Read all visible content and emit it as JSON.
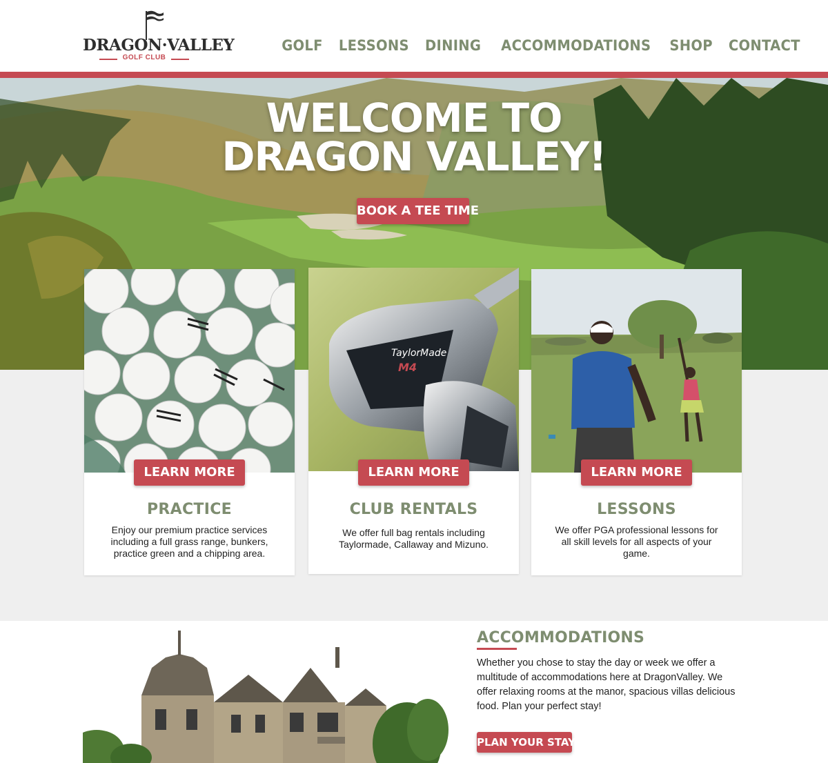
{
  "brand": {
    "name_line": "DRAGON·VALLEY",
    "sub": "GOLF CLUB"
  },
  "nav": {
    "items": [
      "GOLF",
      "LESSONS",
      "DINING",
      "ACCOMMODATIONS",
      "SHOP",
      "CONTACT"
    ]
  },
  "hero": {
    "title_line1": "WELCOME TO",
    "title_line2": "DRAGON VALLEY!",
    "cta": "BOOK A TEE TIME"
  },
  "cards": [
    {
      "title": "PRACTICE",
      "button": "LEARN MORE",
      "description": "Enjoy our premium practice services including a full grass range, bunkers, practice green and a chipping area."
    },
    {
      "title": "CLUB RENTALS",
      "button": "LEARN MORE",
      "description": "We offer full bag rentals including Taylormade, Callaway and Mizuno."
    },
    {
      "title": "LESSONS",
      "button": "LEARN MORE",
      "description": "We offer PGA professional lessons for all skill levels for all aspects of your game."
    }
  ],
  "club_label": "TaylorMade",
  "club_model": "M4",
  "accommodations": {
    "title": "ACCOMMODATIONS",
    "text": "Whether you chose to stay the day or week we offer a multitude of accommodations here at DragonValley. We offer relaxing rooms at the manor, spacious villas delicious food. Plan your perfect stay!",
    "button": "PLAN YOUR STAY"
  },
  "colors": {
    "accent_red": "#c54a52",
    "nav_green": "#7e8d70",
    "background": "#efefef"
  }
}
